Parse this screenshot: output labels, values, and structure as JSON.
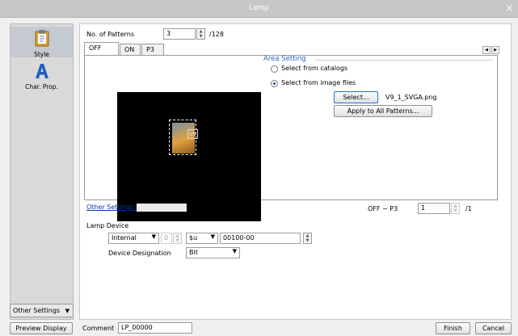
{
  "window": {
    "title": "Lamp",
    "close_glyph": "×"
  },
  "sidebar": {
    "items": [
      {
        "label": "Style",
        "icon": "clipboard-style-icon"
      },
      {
        "label": "Char. Prop.",
        "icon": "letter-a-icon"
      }
    ],
    "other_settings_label": "Other Settings",
    "other_settings_arrow": "▼"
  },
  "patterns": {
    "label": "No. of Patterns",
    "value": "3",
    "max": "/128"
  },
  "tabs": [
    "OFF",
    "ON",
    "P3"
  ],
  "nav": {
    "prev": "◀",
    "next": "▶"
  },
  "preview": {
    "lamp_image_label": "V9",
    "lamp_device_label": "Lamp Device",
    "lamp_device_value": "$u00100-00"
  },
  "area_setting": {
    "title": "Area Setting",
    "option_catalog": "Select from catalogs",
    "option_image": "Select from image files",
    "selected": "image",
    "select_button": "Select...",
    "file_name": "V9_1_SVGA.png",
    "apply_button": "Apply to All Patterns..."
  },
  "other_settings_link": "Other Settings>>",
  "range": {
    "label": "OFF − P3",
    "value": "1",
    "max": "/1"
  },
  "lamp_device": {
    "label": "Lamp Device",
    "type_select": "Internal",
    "index": "0",
    "prefix_select": "$u",
    "address": "00100-00",
    "designation_label": "Device Designation",
    "designation_select": "Bit"
  },
  "bottom": {
    "preview_button": "Preview Display",
    "comment_label": "Comment",
    "comment_value": "LP_00000",
    "finish_button": "Finish",
    "cancel_button": "Cancel"
  }
}
